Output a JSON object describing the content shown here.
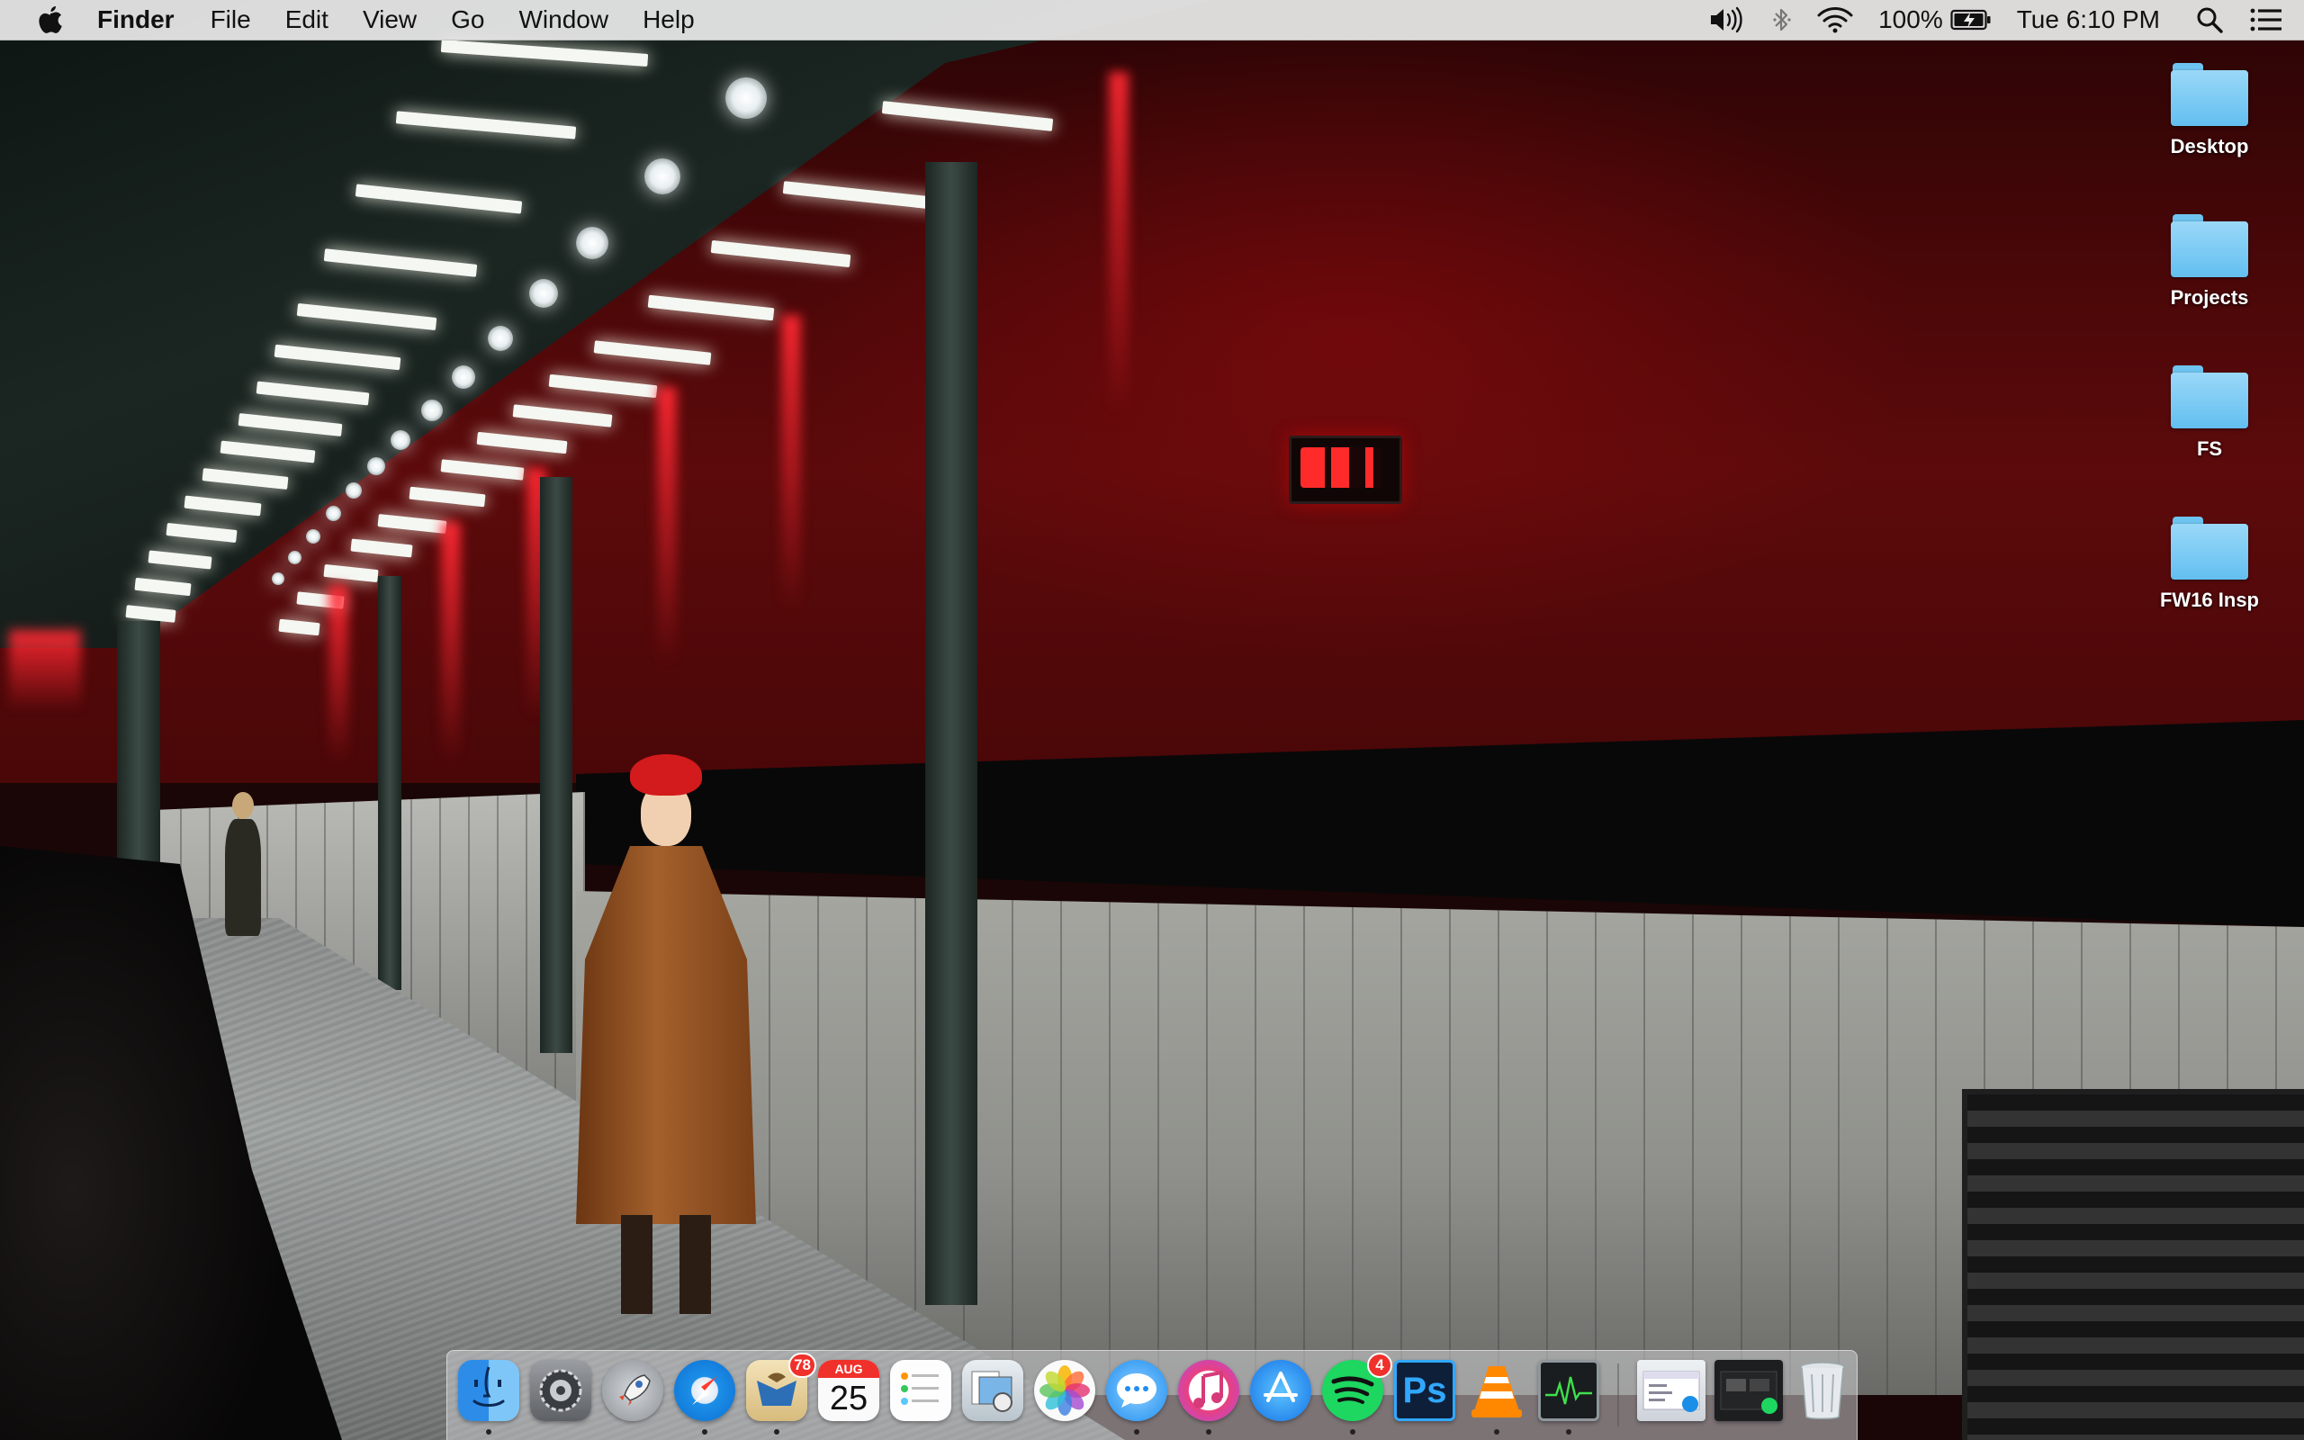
{
  "menubar": {
    "app_name": "Finder",
    "menus": [
      "File",
      "Edit",
      "View",
      "Go",
      "Window",
      "Help"
    ],
    "battery_percent": "100%",
    "clock": "Tue 6:10 PM",
    "status_icons": [
      "volume-icon",
      "bluetooth-icon",
      "wifi-icon",
      "battery-charging-icon",
      "spotlight-search-icon",
      "notification-center-icon"
    ]
  },
  "desktop": {
    "icons": [
      {
        "label": "Desktop",
        "type": "folder"
      },
      {
        "label": "Projects",
        "type": "folder"
      },
      {
        "label": "FS",
        "type": "folder"
      },
      {
        "label": "FW16 Insp",
        "type": "folder"
      }
    ],
    "folder_color": "#62bff0"
  },
  "dock": {
    "apps": [
      {
        "name": "finder-icon",
        "running": true
      },
      {
        "name": "system-preferences-icon",
        "running": false
      },
      {
        "name": "launchpad-icon",
        "running": false
      },
      {
        "name": "safari-icon",
        "running": true
      },
      {
        "name": "mail-icon",
        "running": true,
        "badge": "78"
      },
      {
        "name": "calendar-icon",
        "running": false,
        "month": "AUG",
        "day": "25"
      },
      {
        "name": "reminders-icon",
        "running": false
      },
      {
        "name": "preview-icon",
        "running": false
      },
      {
        "name": "photos-icon",
        "running": false
      },
      {
        "name": "messages-icon",
        "running": true
      },
      {
        "name": "itunes-icon",
        "running": true
      },
      {
        "name": "app-store-icon",
        "running": false
      },
      {
        "name": "spotify-icon",
        "running": true,
        "badge": "4"
      },
      {
        "name": "photoshop-icon",
        "running": false,
        "text": "Ps"
      },
      {
        "name": "vlc-icon",
        "running": true
      },
      {
        "name": "activity-monitor-icon",
        "running": true
      },
      {
        "name": "minimized-window-finder-icon",
        "running": false
      },
      {
        "name": "minimized-window-spotify-icon",
        "running": false
      },
      {
        "name": "trash-icon",
        "running": false
      }
    ]
  }
}
